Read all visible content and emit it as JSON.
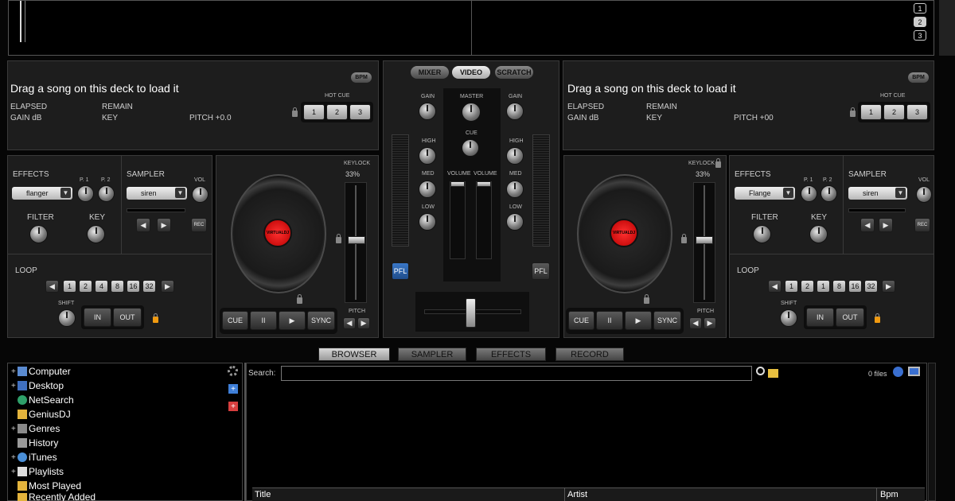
{
  "top_preview": {
    "page_buttons": [
      "1",
      "2",
      "3"
    ]
  },
  "deck_left": {
    "title": "Drag a song on this deck to load it",
    "elapsed": "ELAPSED",
    "remain": "REMAIN",
    "gain": "GAIN dB",
    "key": "KEY",
    "pitch": "PITCH +0.0",
    "bpm_btn": "BPM",
    "hot_cue_label": "HOT CUE",
    "hot_cues": [
      "1",
      "2",
      "3"
    ],
    "effects_label": "EFFECTS",
    "effect_value": "flanger",
    "p1": "P. 1",
    "p2": "P. 2",
    "sampler_label": "SAMPLER",
    "sampler_value": "siren",
    "vol": "VOL",
    "filter": "FILTER",
    "key_knob": "KEY",
    "rec": "REC",
    "loop_label": "LOOP",
    "loop_values": [
      "1",
      "2",
      "4",
      "8",
      "16",
      "32"
    ],
    "shift": "SHIFT",
    "in": "IN",
    "out": "OUT",
    "keylock": "KEYLOCK",
    "keylock_pct": "33%",
    "pitch_label": "PITCH",
    "transport": [
      "CUE",
      "II",
      "▶",
      "SYNC"
    ],
    "platter_label": "VIRTUALDJ"
  },
  "deck_right": {
    "title": "Drag a song on this deck to load it",
    "elapsed": "ELAPSED",
    "remain": "REMAIN",
    "gain": "GAIN dB",
    "key": "KEY",
    "pitch": "PITCH +00",
    "bpm_btn": "BPM",
    "hot_cue_label": "HOT CUE",
    "hot_cues": [
      "1",
      "2",
      "3"
    ],
    "effects_label": "EFFECTS",
    "effect_value": "Flange",
    "p1": "P. 1",
    "p2": "P. 2",
    "sampler_label": "SAMPLER",
    "sampler_value": "siren",
    "vol": "VOL",
    "filter": "FILTER",
    "key_knob": "KEY",
    "rec": "REC",
    "loop_label": "LOOP",
    "loop_values": [
      "1",
      "2",
      "1",
      "8",
      "16",
      "32"
    ],
    "shift": "SHIFT",
    "in": "IN",
    "out": "OUT",
    "keylock": "KEYLOCK",
    "keylock_pct": "33%",
    "pitch_label": "PITCH",
    "transport": [
      "CUE",
      "II",
      "▶",
      "SYNC"
    ],
    "platter_label": "VIRTUALDJ"
  },
  "mixer": {
    "tabs": [
      "MIXER",
      "VIDEO",
      "SCRATCH"
    ],
    "gain": "GAIN",
    "master": "MASTER",
    "cue": "CUE",
    "high": "HIGH",
    "med": "MED",
    "low": "LOW",
    "volume": "VOLUME",
    "pfl": "PFL"
  },
  "bottom_tabs": [
    "BROWSER",
    "SAMPLER",
    "EFFECTS",
    "RECORD"
  ],
  "browser": {
    "tree": [
      "Computer",
      "Desktop",
      "NetSearch",
      "GeniusDJ",
      "Genres",
      "History",
      "iTunes",
      "Playlists",
      "Most Played",
      "Recently Added"
    ],
    "search_label": "Search:",
    "search_value": "",
    "file_count": "0 files",
    "columns": [
      "Title",
      "Artist",
      "Bpm"
    ]
  },
  "colors": {
    "accent_red": "#e00000",
    "pfl_blue": "#2a5fa8",
    "lock_orange": "#f09a10"
  }
}
